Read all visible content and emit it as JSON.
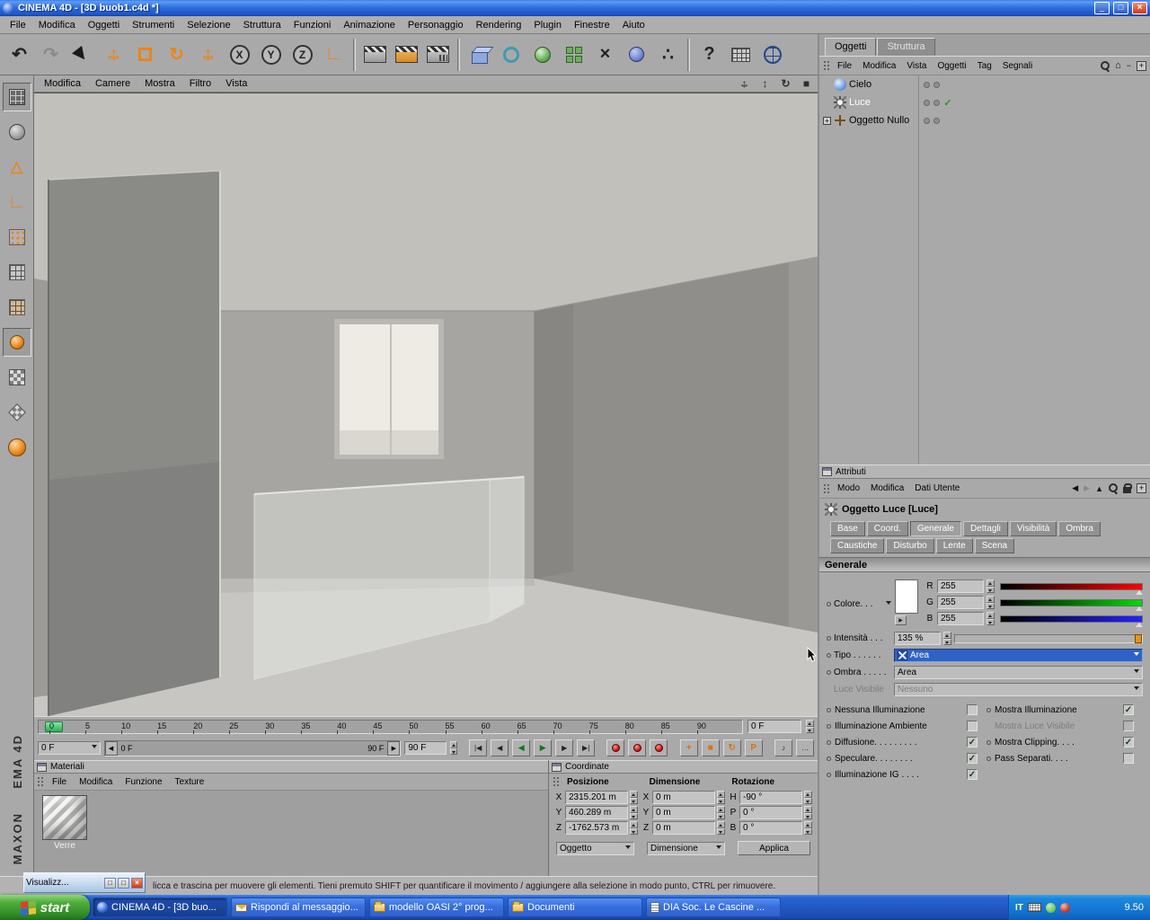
{
  "window": {
    "title": "CINEMA 4D - [3D buob1.c4d *]"
  },
  "menubar": [
    "File",
    "Modifica",
    "Oggetti",
    "Strumenti",
    "Selezione",
    "Struttura",
    "Funzioni",
    "Animazione",
    "Personaggio",
    "Rendering",
    "Plugin",
    "Finestre",
    "Aiuto"
  ],
  "icons": {
    "undo": "↶",
    "redo": "↷",
    "axis_x": "X",
    "axis_y": "Y",
    "axis_z": "Z",
    "coord_system": "∟",
    "deformer": "×",
    "particles": "∴",
    "help": "?",
    "zoom_view": "↕",
    "rotate_view": "↻",
    "maximize_view": "■",
    "goto_start": "|◀",
    "prev_frame": "◀",
    "play_backward": "◀",
    "play_forward": "▶",
    "next_frame": "▶",
    "goto_end": "▶|",
    "sound": "♪",
    "more": "…",
    "record_pos": "+",
    "record_scale": "■",
    "record_rot": "↻",
    "record_param": "P",
    "back": "◀",
    "forward": "▶",
    "up": "▲",
    "home": "⌂",
    "plus": "+",
    "minus": "−",
    "check": "✓",
    "min": "_",
    "max": "□",
    "close": "×",
    "expand_right": "▶"
  },
  "viewport": {
    "menu": [
      "Modifica",
      "Camere",
      "Mostra",
      "Filtro",
      "Vista"
    ]
  },
  "timeline": {
    "ticks": [
      "0",
      "5",
      "10",
      "15",
      "20",
      "25",
      "30",
      "35",
      "40",
      "45",
      "50",
      "55",
      "60",
      "65",
      "70",
      "75",
      "80",
      "85",
      "90"
    ],
    "frame_field": "0 F",
    "current_frame": "0 F",
    "range_start": "0 F",
    "range_end": "90 F",
    "end_field": "90 F"
  },
  "materials": {
    "title": "Materiali",
    "menu": [
      "File",
      "Modifica",
      "Funzione",
      "Texture"
    ],
    "items": [
      {
        "name": "Verre"
      }
    ]
  },
  "coordinates": {
    "title": "Coordinate",
    "headers": [
      "Posizione",
      "Dimensione",
      "Rotazione"
    ],
    "rows": [
      {
        "pos_axis": "X",
        "pos": "2315.201 m",
        "dim_axis": "X",
        "dim": "0 m",
        "rot_axis": "H",
        "rot": "-90 °"
      },
      {
        "pos_axis": "Y",
        "pos": "460.289 m",
        "dim_axis": "Y",
        "dim": "0 m",
        "rot_axis": "P",
        "rot": "0 °"
      },
      {
        "pos_axis": "Z",
        "pos": "-1762.573 m",
        "dim_axis": "Z",
        "dim": "0 m",
        "rot_axis": "B",
        "rot": "0 °"
      }
    ],
    "mode_left": "Oggetto",
    "mode_middle": "Dimensione",
    "apply": "Applica"
  },
  "object_manager": {
    "tabs": [
      "Oggetti",
      "Struttura"
    ],
    "menu": [
      "File",
      "Modifica",
      "Vista",
      "Oggetti",
      "Tag",
      "Segnali"
    ],
    "objects": [
      {
        "name": "Cielo"
      },
      {
        "name": "Luce"
      },
      {
        "name": "Oggetto Nullo"
      }
    ]
  },
  "attributes": {
    "panel_title": "Attributi",
    "menu": [
      "Modo",
      "Modifica",
      "Dati Utente"
    ],
    "object_title": "Oggetto Luce [Luce]",
    "tabs_row1": [
      "Base",
      "Coord.",
      "Generale",
      "Dettagli",
      "Visibilità",
      "Ombra"
    ],
    "tabs_row2": [
      "Caustiche",
      "Disturbo",
      "Lente",
      "Scena"
    ],
    "active_tab": "Generale",
    "section_title": "Generale",
    "color_label": "Colore. . .",
    "channels": [
      {
        "label": "R",
        "value": "255"
      },
      {
        "label": "G",
        "value": "255"
      },
      {
        "label": "B",
        "value": "255"
      }
    ],
    "intensity_label": "Intensità . . .",
    "intensity_value": "135 %",
    "type_label": "Tipo . . . . . .",
    "type_value": "Area",
    "shadow_label": "Ombra . . . . .",
    "shadow_value": "Area",
    "visible_light_label": "Luce Visibile",
    "visible_light_value": "Nessuno",
    "checks_left": [
      {
        "label": "Nessuna Illuminazione",
        "checked": false
      },
      {
        "label": "Illuminazione Ambiente",
        "checked": false
      },
      {
        "label": "Diffusione. . . . . . . . .",
        "checked": true
      },
      {
        "label": "Speculare. . . . . . . .",
        "checked": true
      },
      {
        "label": "Illuminazione IG . . . .",
        "checked": true
      }
    ],
    "checks_right": [
      {
        "label": "Mostra Illuminazione",
        "checked": true
      },
      {
        "label": "Mostra Luce Visibile",
        "checked": false
      },
      {
        "label": "Mostra Clipping. . . .",
        "checked": true
      },
      {
        "label": "Pass Separati. . . .",
        "checked": false
      }
    ]
  },
  "status_bar": {
    "text": "licca e trascina per muovere gli elementi. Tieni premuto SHIFT per quantificare il movimento / aggiungere alla selezione in modo punto, CTRL per rimuovere."
  },
  "mini_window": {
    "title": "Visualizz..."
  },
  "branding": {
    "line1": "EMA 4D",
    "line2": "MAXON"
  },
  "taskbar": {
    "start": "start",
    "tasks": [
      "CINEMA 4D - [3D buo...",
      "Rispondi al messaggio...",
      "modello OASI 2° prog...",
      "Documenti",
      "DIA Soc. Le Cascine ..."
    ],
    "tray": {
      "lang": "IT",
      "time": "9.50"
    }
  }
}
